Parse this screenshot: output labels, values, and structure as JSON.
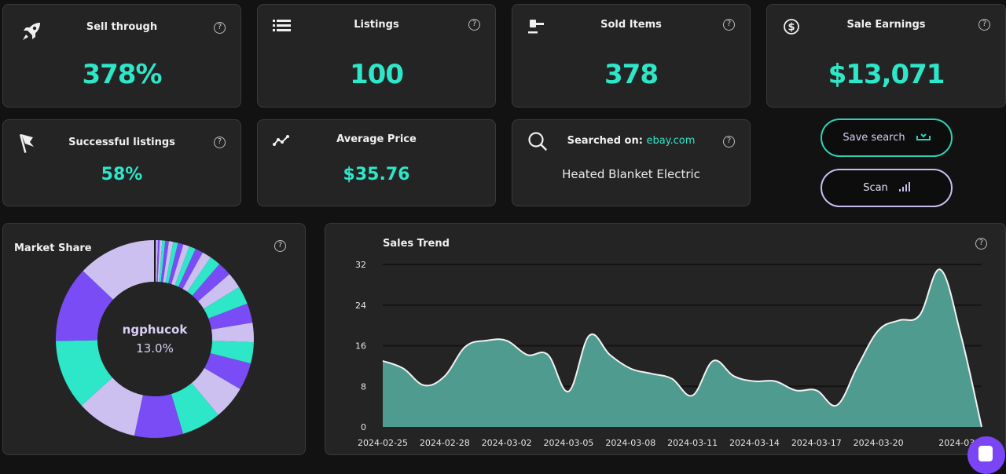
{
  "stats": {
    "sell_through": {
      "title": "Sell through",
      "value": "378%",
      "icon": "rocket-icon"
    },
    "listings": {
      "title": "Listings",
      "value": "100",
      "icon": "list-icon"
    },
    "sold_items": {
      "title": "Sold Items",
      "value": "378",
      "icon": "gavel-icon"
    },
    "sale_earnings": {
      "title": "Sale Earnings",
      "value": "$13,071",
      "icon": "dollar-circle-icon"
    },
    "successful_listings": {
      "title": "Successful listings",
      "value": "58%",
      "icon": "flag-icon"
    },
    "average_price": {
      "title": "Average Price",
      "value": "$35.76",
      "icon": "trend-line-icon"
    }
  },
  "search": {
    "label": "Searched on:",
    "site": "ebay.com",
    "query": "Heated Blanket Electric",
    "icon": "search-icon"
  },
  "actions": {
    "save_search": "Save search",
    "scan": "Scan"
  },
  "help_glyph": "?",
  "colors": {
    "accent": "#2ee6c8",
    "purple": "#7a4cf5",
    "lavender": "#cbc0f0",
    "area_fill": "#4f9b90",
    "background": "#121212",
    "card": "#242424"
  },
  "market_share": {
    "title": "Market Share",
    "center_label": "ngphucok",
    "center_value": "13.0%"
  },
  "chart_data": [
    {
      "type": "pie",
      "title": "Market Share",
      "donut": true,
      "highlighted": {
        "label": "ngphucok",
        "value": 13.0
      },
      "slices": [
        {
          "value": 13.0,
          "color": "#cbc0f0"
        },
        {
          "value": 12.5,
          "color": "#7a4cf5"
        },
        {
          "value": 11.5,
          "color": "#2ee6c8"
        },
        {
          "value": 10.0,
          "color": "#cbc0f0"
        },
        {
          "value": 8.0,
          "color": "#7a4cf5"
        },
        {
          "value": 6.5,
          "color": "#2ee6c8"
        },
        {
          "value": 5.5,
          "color": "#cbc0f0"
        },
        {
          "value": 4.5,
          "color": "#7a4cf5"
        },
        {
          "value": 3.5,
          "color": "#2ee6c8"
        },
        {
          "value": 3.2,
          "color": "#cbc0f0"
        },
        {
          "value": 3.2,
          "color": "#7a4cf5"
        },
        {
          "value": 3.0,
          "color": "#2ee6c8"
        },
        {
          "value": 2.6,
          "color": "#cbc0f0"
        },
        {
          "value": 2.3,
          "color": "#7a4cf5"
        },
        {
          "value": 1.8,
          "color": "#2ee6c8"
        },
        {
          "value": 1.5,
          "color": "#cbc0f0"
        },
        {
          "value": 1.3,
          "color": "#7a4cf5"
        },
        {
          "value": 1.1,
          "color": "#2ee6c8"
        },
        {
          "value": 1.0,
          "color": "#cbc0f0"
        },
        {
          "value": 0.9,
          "color": "#7a4cf5"
        },
        {
          "value": 0.8,
          "color": "#2ee6c8"
        },
        {
          "value": 0.7,
          "color": "#cbc0f0"
        },
        {
          "value": 0.6,
          "color": "#7a4cf5"
        },
        {
          "value": 0.5,
          "color": "#2ee6c8"
        },
        {
          "value": 0.4,
          "color": "#cbc0f0"
        },
        {
          "value": 0.3,
          "color": "#7a4cf5"
        },
        {
          "value": 0.3,
          "color": "#cbc0f0"
        },
        {
          "value": 0.2,
          "color": "#7a4cf5"
        }
      ]
    },
    {
      "type": "area",
      "title": "Sales Trend",
      "xlabel": "",
      "ylabel": "",
      "ylim": [
        0,
        32
      ],
      "yticks": [
        0,
        8,
        16,
        24,
        32
      ],
      "grid": true,
      "xtick_labels": [
        "2024-02-25",
        "2024-02-28",
        "2024-03-02",
        "2024-03-05",
        "2024-03-08",
        "2024-03-11",
        "2024-03-14",
        "2024-03-17",
        "2024-03-20",
        "2024-03-2"
      ],
      "x": [
        "2024-02-25",
        "2024-02-26",
        "2024-02-27",
        "2024-02-28",
        "2024-02-29",
        "2024-03-01",
        "2024-03-02",
        "2024-03-03",
        "2024-03-04",
        "2024-03-05",
        "2024-03-06",
        "2024-03-07",
        "2024-03-08",
        "2024-03-09",
        "2024-03-10",
        "2024-03-11",
        "2024-03-12",
        "2024-03-13",
        "2024-03-14",
        "2024-03-15",
        "2024-03-16",
        "2024-03-17",
        "2024-03-18",
        "2024-03-19",
        "2024-03-20",
        "2024-03-21",
        "2024-03-22",
        "2024-03-23",
        "2024-03-24",
        "2024-03-25"
      ],
      "series": [
        {
          "name": "Sales",
          "values": [
            13,
            11.5,
            8.2,
            10,
            15.8,
            17,
            17,
            14.2,
            14.2,
            7,
            18,
            14.2,
            11.5,
            10.5,
            9.5,
            6.2,
            13,
            10,
            9,
            9,
            7.2,
            7.2,
            4.3,
            12,
            19,
            21,
            22,
            31,
            18,
            0
          ]
        }
      ]
    }
  ]
}
